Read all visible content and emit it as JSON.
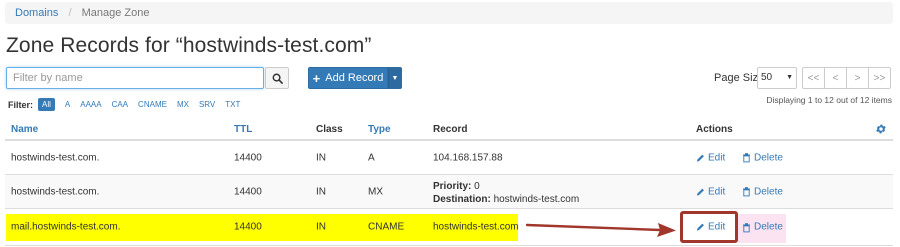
{
  "breadcrumb": {
    "link": "Domains",
    "separator": "/",
    "current": "Manage Zone"
  },
  "page_title": "Zone Records for “hostwinds-test.com”",
  "search": {
    "placeholder": "Filter by name",
    "value": ""
  },
  "add_record_label": "Add Record",
  "page_size": {
    "label": "Page Size",
    "value": "50"
  },
  "pager": [
    "<<",
    "<",
    ">",
    ">>"
  ],
  "displaying": "Displaying 1 to 12 out of 12 items",
  "filter": {
    "label": "Filter:",
    "items": [
      "All",
      "A",
      "AAAA",
      "CAA",
      "CNAME",
      "MX",
      "SRV",
      "TXT"
    ]
  },
  "table": {
    "headers": {
      "name": "Name",
      "ttl": "TTL",
      "class": "Class",
      "type": "Type",
      "record": "Record",
      "actions": "Actions"
    },
    "rows": [
      {
        "name": "hostwinds-test.com.",
        "ttl": "14400",
        "class": "IN",
        "type": "A",
        "record": "104.168.157.88",
        "edit": "Edit",
        "delete": "Delete"
      },
      {
        "name": "hostwinds-test.com.",
        "ttl": "14400",
        "class": "IN",
        "type": "MX",
        "priority_label": "Priority:",
        "priority_value": "0",
        "destination_label": "Destination:",
        "destination_value": "hostwinds-test.com",
        "edit": "Edit",
        "delete": "Delete"
      },
      {
        "name": "mail.hostwinds-test.com.",
        "ttl": "14400",
        "class": "IN",
        "type": "CNAME",
        "record": "hostwinds-test.com",
        "edit": "Edit",
        "delete": "Delete"
      }
    ]
  },
  "colors": {
    "link": "#337ab7",
    "primary_button": "#337ab7",
    "highlight": "#ffff00",
    "annotation": "#a1372c"
  },
  "icons": {
    "search": "search-icon",
    "plus": "plus-icon",
    "settings": "gear-icon",
    "edit": "pencil-icon",
    "delete": "trash-icon",
    "annotation_arrow": "arrow-right-icon"
  }
}
